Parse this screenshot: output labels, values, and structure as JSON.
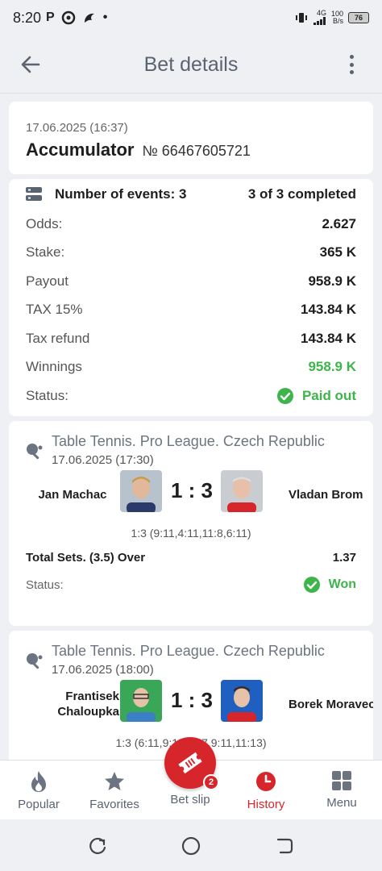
{
  "status_bar": {
    "time": "8:20",
    "network_gen": "4G",
    "speed_value": "100",
    "speed_unit": "B/s",
    "battery": "76"
  },
  "header": {
    "title": "Bet details"
  },
  "bet": {
    "date": "17.06.2025 (16:37)",
    "type": "Accumulator",
    "number": "№ 66467605721"
  },
  "summary": {
    "events_label": "Number of events: 3",
    "completed": "3 of 3 completed",
    "rows": [
      {
        "key": "Odds:",
        "value": "2.627"
      },
      {
        "key": "Stake:",
        "value": "365 K"
      },
      {
        "key": "Payout",
        "value": "958.9 K"
      },
      {
        "key": "TAX 15%",
        "value": "143.84 K"
      },
      {
        "key": "Tax refund",
        "value": "143.84 K"
      },
      {
        "key": "Winnings",
        "value": "958.9 K"
      }
    ],
    "status_label": "Status:",
    "status_value": "Paid out"
  },
  "events": [
    {
      "league": "Table Tennis. Pro League. Czech Republic",
      "date": "17.06.2025 (17:30)",
      "team1": "Jan Machac",
      "team2": "Vladan Brom",
      "score": "1 : 3",
      "sets": "1:3 (9:11,4:11,11:8,6:11)",
      "market": "Total Sets. (3.5) Over",
      "odds": "1.37",
      "status_label": "Status:",
      "status_value": "Won"
    },
    {
      "league": "Table Tennis. Pro League. Czech Republic",
      "date": "17.06.2025 (18:00)",
      "team1": "Frantisek Chaloupka",
      "team2": "Borek Moravec",
      "score": "1 : 3",
      "sets": "1:3 (6:11,9:11,11:7,9:11,11:13)"
    }
  ],
  "nav": {
    "items": [
      {
        "label": "Popular",
        "icon": "flame-icon"
      },
      {
        "label": "Favorites",
        "icon": "star-icon"
      },
      {
        "label": "Bet slip",
        "icon": "ticket-icon"
      },
      {
        "label": "History",
        "icon": "clock-icon"
      },
      {
        "label": "Menu",
        "icon": "grid-icon"
      }
    ],
    "badge": "2",
    "active": "History"
  },
  "colors": {
    "accent": "#d7262b",
    "success": "#3db54a",
    "background": "#eef0f3"
  }
}
